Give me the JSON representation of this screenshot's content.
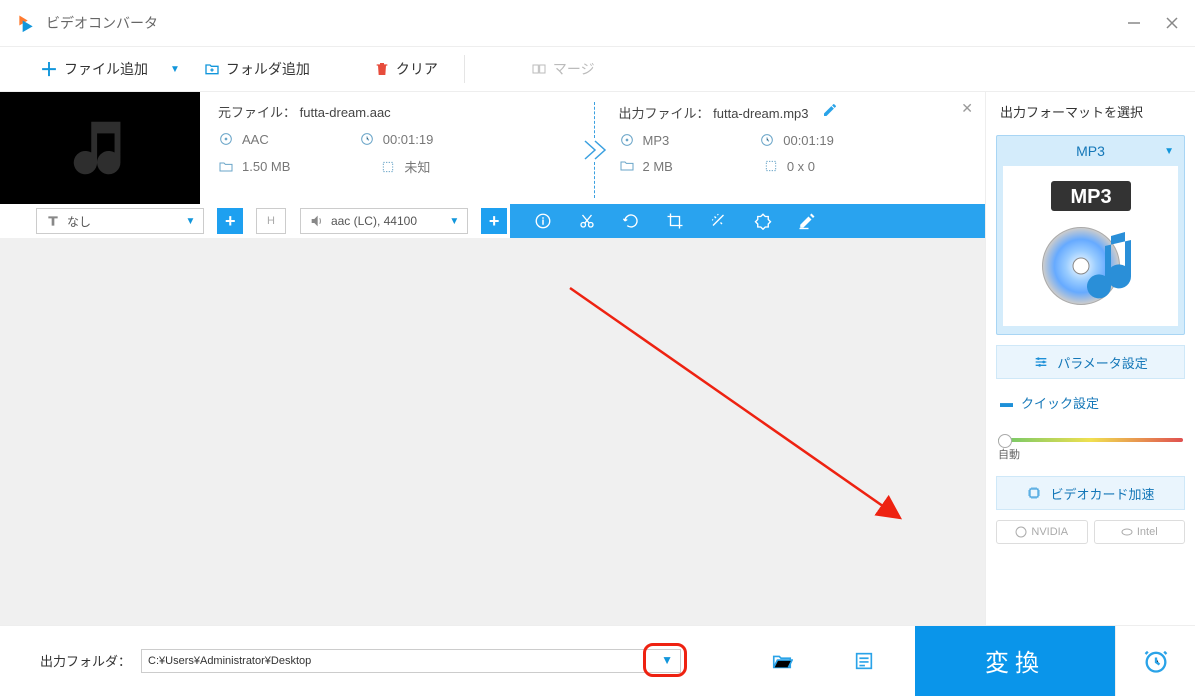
{
  "app": {
    "title": "ビデオコンバータ"
  },
  "toolbar": {
    "add_file": "ファイル追加",
    "add_folder": "フォルダ追加",
    "clear": "クリア",
    "merge": "マージ"
  },
  "file": {
    "source_label": "元ファイル：",
    "source_name": "futta-dream.aac",
    "output_label": "出力ファイル：",
    "output_name": "futta-dream.mp3",
    "src_fmt": "AAC",
    "src_dur": "00:01:19",
    "src_size": "1.50 MB",
    "src_res": "未知",
    "out_fmt": "MP3",
    "out_dur": "00:01:19",
    "out_size": "2 MB",
    "out_res": "0 x 0"
  },
  "bluebar": {
    "subtitle_none": "なし",
    "audio_info": "aac (LC), 44100"
  },
  "right": {
    "title": "出力フォーマットを選択",
    "format": "MP3",
    "param_btn": "パラメータ設定",
    "quick": "クイック設定",
    "auto": "自動",
    "gpu": "ビデオカード加速",
    "chip1": "NVIDIA",
    "chip2": "Intel"
  },
  "bottom": {
    "out_label": "出力フォルダ：",
    "out_path": "C:¥Users¥Administrator¥Desktop",
    "convert": "変換"
  }
}
